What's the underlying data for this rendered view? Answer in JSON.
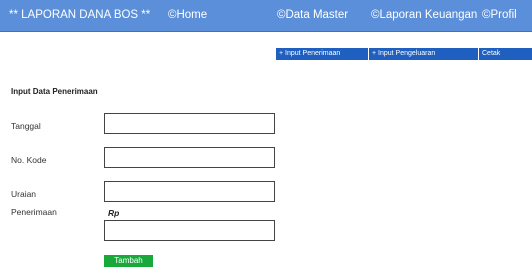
{
  "header": {
    "app_title": "** LAPORAN DANA BOS  **",
    "nav": [
      {
        "label": "©Home"
      },
      {
        "label": "©Data Master"
      },
      {
        "label": "©Laporan Keuangan"
      },
      {
        "label": "©Profil"
      }
    ]
  },
  "subnav": [
    {
      "label": "+ Input Penerimaan"
    },
    {
      "label": "+ Input Pengeluaran"
    },
    {
      "label": "Cetak"
    }
  ],
  "form": {
    "title": "Input Data Penerimaan",
    "fields": [
      {
        "label": "Tanggal",
        "value": ""
      },
      {
        "label": "No. Kode",
        "value": ""
      },
      {
        "label": "Uraian",
        "value": ""
      }
    ],
    "penerimaan_label": "Penerimaan",
    "currency_prefix": "Rp",
    "penerimaan_value": "",
    "submit_label": "Tambah"
  },
  "colors": {
    "header_bg": "#5b8fd9",
    "subnav_bg": "#1f5fbf",
    "button_bg": "#18a93a"
  }
}
